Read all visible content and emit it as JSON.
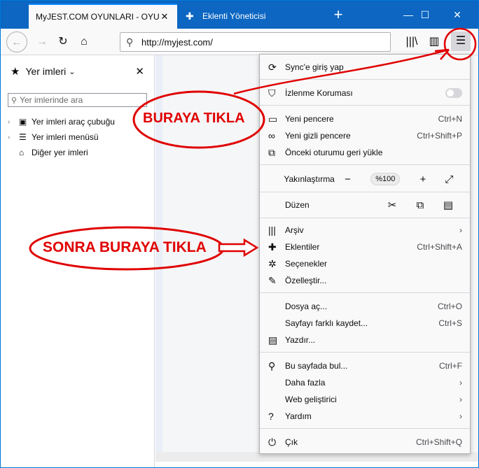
{
  "tabs": [
    {
      "title": "MyJEST.COM OYUNLARI - OYUNLAR",
      "active": true
    },
    {
      "title": "Eklenti Yöneticisi",
      "active": false
    }
  ],
  "address": {
    "url": "http://myjest.com/"
  },
  "sidebar": {
    "title": "Yer imleri",
    "search_placeholder": "Yer imlerinde ara",
    "items": [
      {
        "label": "Yer imleri araç çubuğu"
      },
      {
        "label": "Yer imleri menüsü"
      },
      {
        "label": "Diğer yer imleri"
      }
    ]
  },
  "menu": {
    "sync": "Sync'e giriş yap",
    "tracking": "İzlenme Koruması",
    "new_window": {
      "label": "Yeni pencere",
      "shortcut": "Ctrl+N"
    },
    "private_window": {
      "label": "Yeni gizli pencere",
      "shortcut": "Ctrl+Shift+P"
    },
    "restore": "Önceki oturumu geri yükle",
    "zoom": {
      "label": "Yakınlaştırma",
      "value": "%100"
    },
    "edit": "Düzen",
    "library": "Arşiv",
    "addons": {
      "label": "Eklentiler",
      "shortcut": "Ctrl+Shift+A"
    },
    "options": "Seçenekler",
    "customize": "Özelleştir...",
    "open_file": {
      "label": "Dosya aç...",
      "shortcut": "Ctrl+O"
    },
    "save_as": {
      "label": "Sayfayı farklı kaydet...",
      "shortcut": "Ctrl+S"
    },
    "print": "Yazdır...",
    "find": {
      "label": "Bu sayfada bul...",
      "shortcut": "Ctrl+F"
    },
    "more": "Daha fazla",
    "web_dev": "Web geliştirici",
    "help": "Yardım",
    "quit": {
      "label": "Çık",
      "shortcut": "Ctrl+Shift+Q"
    }
  },
  "annotations": {
    "first": "BURAYA TIKLA",
    "second": "SONRA BURAYA TIKLA"
  },
  "colors": {
    "annotation": "#e00000",
    "titlebar": "#0c66c2"
  }
}
